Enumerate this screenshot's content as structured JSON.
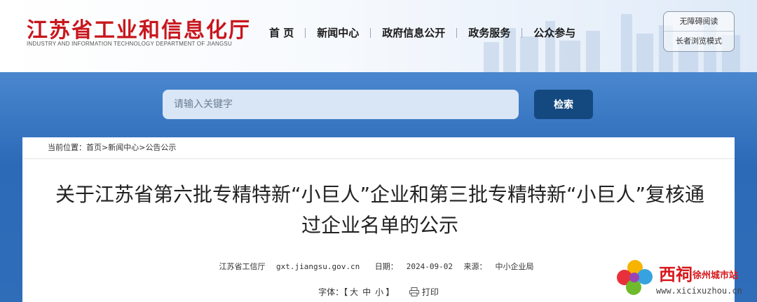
{
  "header": {
    "logo_cn": "江苏省工业和信息化厅",
    "logo_en": "INDUSTRY AND INFORMATION TECHNOLOGY DEPARTMENT OF JIANGSU",
    "nav": [
      "首 页",
      "新闻中心",
      "政府信息公开",
      "政务服务",
      "公众参与"
    ],
    "accessibility": [
      "无障碍阅读",
      "长者浏览模式"
    ]
  },
  "search": {
    "placeholder": "请输入关键字",
    "button": "检索"
  },
  "breadcrumb": {
    "label": "当前位置：",
    "items": [
      "首页",
      "新闻中心",
      "公告公示"
    ],
    "sep": ">"
  },
  "article": {
    "title": "关于江苏省第六批专精特新“小巨人”企业和第三批专精特新“小巨人”复核通过企业名单的公示",
    "source": "江苏省工信厅",
    "site": "gxt.jiangsu.gov.cn",
    "date_label": "日期：",
    "date": "2024-09-02",
    "from_label": "来源：",
    "from": "中小企业局"
  },
  "tools": {
    "font_label": "字体：【",
    "sizes": [
      "大",
      "中",
      "小"
    ],
    "font_end": "】",
    "print": "打印"
  },
  "watermark": {
    "name": "西祠",
    "city": "徐州城市站",
    "url": "www.xicixuzhou.cn"
  },
  "colors": {
    "brand_red": "#c8161d",
    "band_blue": "#2c6ab8",
    "button_navy": "#14497f"
  }
}
